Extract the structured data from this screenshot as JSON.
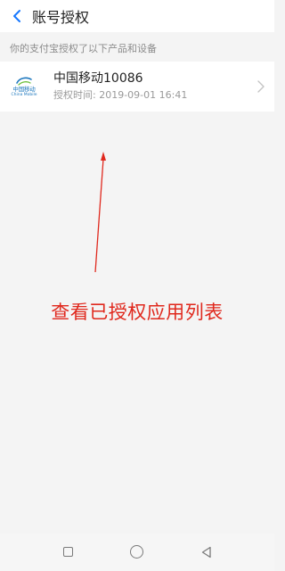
{
  "header": {
    "title": "账号授权",
    "back_icon": "chevron-left-icon"
  },
  "section_note": "你的支付宝授权了以下产品和设备",
  "apps": [
    {
      "name": "中国移动10086",
      "auth_time": "授权时间: 2019-09-01 16:41",
      "logo": {
        "cn": "中国移动",
        "en": "China Mobile"
      }
    }
  ],
  "annotation": {
    "text": "查看已授权应用列表",
    "color": "#e0281d"
  },
  "nav": {
    "items": [
      "recent-apps-icon",
      "home-icon",
      "back-icon"
    ]
  },
  "colors": {
    "accent": "#1677ff",
    "background": "#f4f4f4",
    "annotation": "#e0281d"
  }
}
